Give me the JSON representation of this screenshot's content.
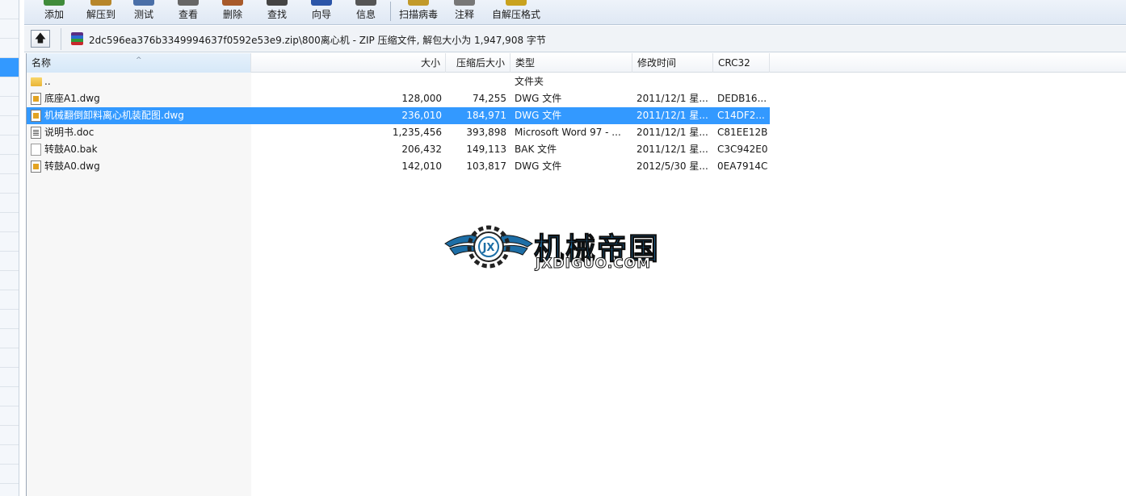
{
  "toolbar": {
    "buttons": [
      {
        "label": "添加",
        "icon": "add-icon",
        "color": "#3f8b3a"
      },
      {
        "label": "解压到",
        "icon": "extract-icon",
        "color": "#b7862a"
      },
      {
        "label": "测试",
        "icon": "test-icon",
        "color": "#4a6fa8"
      },
      {
        "label": "查看",
        "icon": "view-icon",
        "color": "#666666"
      },
      {
        "label": "删除",
        "icon": "delete-icon",
        "color": "#a85a2a"
      },
      {
        "label": "查找",
        "icon": "find-icon",
        "color": "#444444"
      },
      {
        "label": "向导",
        "icon": "wizard-icon",
        "color": "#2b55a8"
      },
      {
        "label": "信息",
        "icon": "info-icon",
        "color": "#555555"
      },
      {
        "label": "扫描病毒",
        "icon": "virus-scan-icon",
        "color": "#c29a2a"
      },
      {
        "label": "注释",
        "icon": "comment-icon",
        "color": "#777777"
      },
      {
        "label": "自解压格式",
        "icon": "sfx-icon",
        "color": "#c9a21e"
      }
    ]
  },
  "address": {
    "text": "2dc596ea376b3349994637f0592e53e9.zip\\800离心机 - ZIP 压缩文件, 解包大小为 1,947,908 字节"
  },
  "columns": {
    "name": "名称",
    "size": "大小",
    "packed": "压缩后大小",
    "type": "类型",
    "modified": "修改时间",
    "crc": "CRC32"
  },
  "files": [
    {
      "name": "..",
      "size": "",
      "packed": "",
      "type": "文件夹",
      "modified": "",
      "crc": "",
      "icon": "folder-icon"
    },
    {
      "name": "底座A1.dwg",
      "size": "128,000",
      "packed": "74,255",
      "type": "DWG 文件",
      "modified": "2011/12/1 星...",
      "crc": "DEDB16...",
      "icon": "dwg-file-icon"
    },
    {
      "name": "机械翻倒卸料离心机装配图.dwg",
      "size": "236,010",
      "packed": "184,971",
      "type": "DWG 文件",
      "modified": "2011/12/1 星...",
      "crc": "C14DF2...",
      "icon": "dwg-file-icon",
      "selected": true
    },
    {
      "name": "说明书.doc",
      "size": "1,235,456",
      "packed": "393,898",
      "type": "Microsoft Word 97 - ...",
      "modified": "2011/12/1 星...",
      "crc": "C81EE12B",
      "icon": "doc-file-icon"
    },
    {
      "name": "转鼓A0.bak",
      "size": "206,432",
      "packed": "149,113",
      "type": "BAK 文件",
      "modified": "2011/12/1 星...",
      "crc": "C3C942E0",
      "icon": "bak-file-icon"
    },
    {
      "name": "转鼓A0.dwg",
      "size": "142,010",
      "packed": "103,817",
      "type": "DWG 文件",
      "modified": "2012/5/30 星...",
      "crc": "0EA7914C",
      "icon": "dwg-file-icon"
    }
  ],
  "watermark": {
    "title": "机械帝国",
    "subtitle": "JXDIGUO.COM"
  },
  "colors": {
    "selection": "#3399ff",
    "watermark_blue": "#1d6ea6"
  }
}
